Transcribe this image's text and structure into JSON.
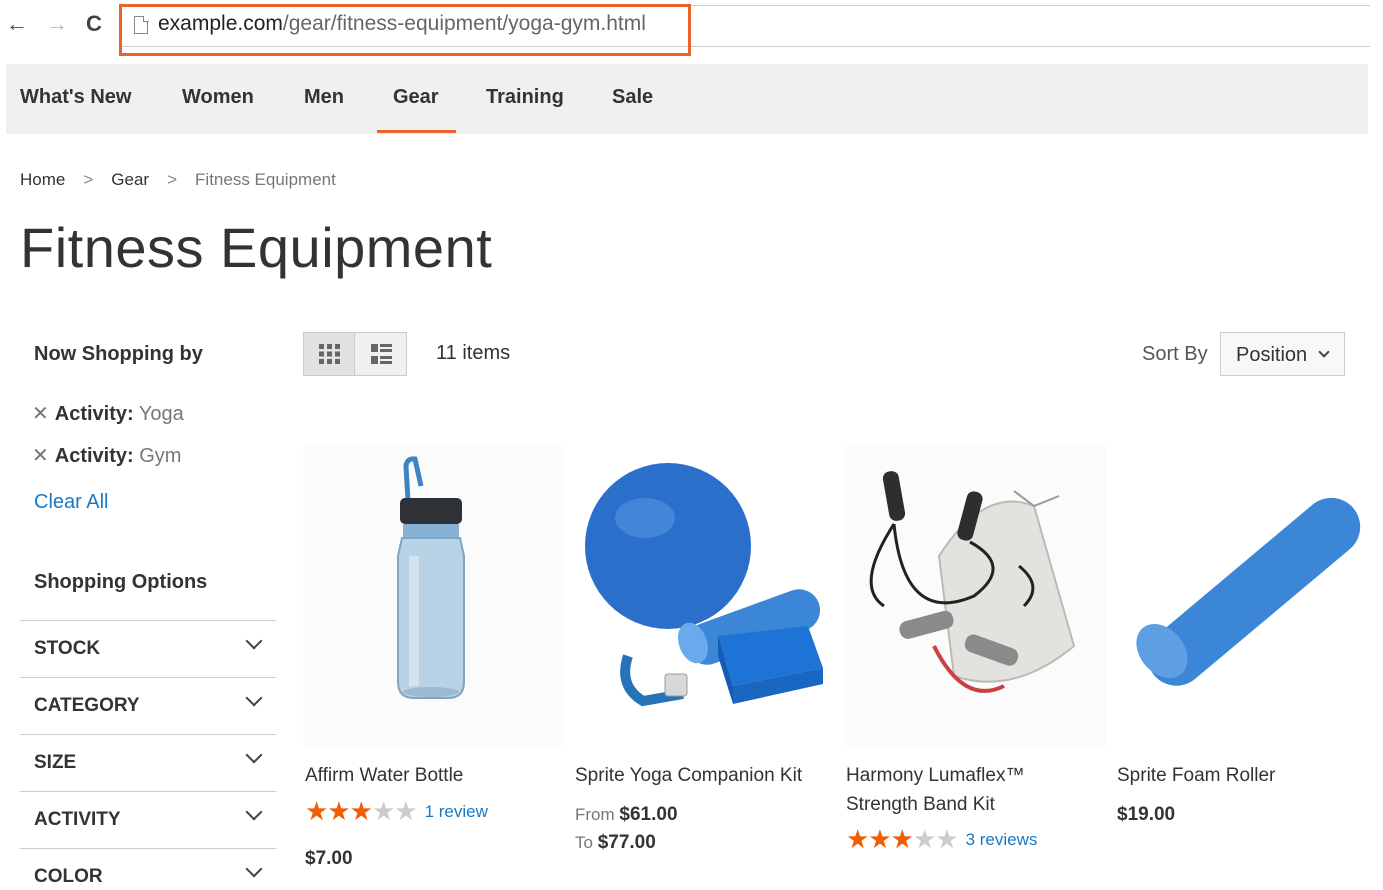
{
  "browser": {
    "url_host": "example.com",
    "url_path": "/gear/fitness-equipment/yoga-gym.html",
    "back_label": "←",
    "forward_label": "→",
    "reload_label": "C"
  },
  "nav": {
    "items": [
      "What's New",
      "Women",
      "Men",
      "Gear",
      "Training",
      "Sale"
    ],
    "active": "Gear"
  },
  "breadcrumb": {
    "home": "Home",
    "gear": "Gear",
    "current": "Fitness Equipment"
  },
  "page_title": "Fitness Equipment",
  "sidebar": {
    "now_shopping_heading": "Now Shopping by",
    "filters": [
      {
        "name": "Activity:",
        "value": "Yoga"
      },
      {
        "name": "Activity:",
        "value": "Gym"
      }
    ],
    "clear_all": "Clear All",
    "shopping_options_heading": "Shopping Options",
    "facets": [
      "STOCK",
      "CATEGORY",
      "SIZE",
      "ACTIVITY",
      "COLOR"
    ]
  },
  "toolbar": {
    "items_count": "11 items",
    "sort_label": "Sort By",
    "sort_value": "Position"
  },
  "products": [
    {
      "name": "Affirm Water Bottle",
      "rating_stars": 3,
      "reviews": "1 review",
      "price": "$7.00"
    },
    {
      "name": "Sprite Yoga Companion Kit",
      "price_from_label": "From",
      "price_from": "$61.00",
      "price_to_label": "To",
      "price_to": "$77.00"
    },
    {
      "name": "Harmony Lumaflex™ Strength Band Kit",
      "rating_stars": 3,
      "reviews": "3 reviews"
    },
    {
      "name": "Sprite Foam Roller",
      "price": "$19.00"
    }
  ],
  "colors": {
    "accent": "#e8642c",
    "link": "#1979c3",
    "star": "#f25c05"
  }
}
